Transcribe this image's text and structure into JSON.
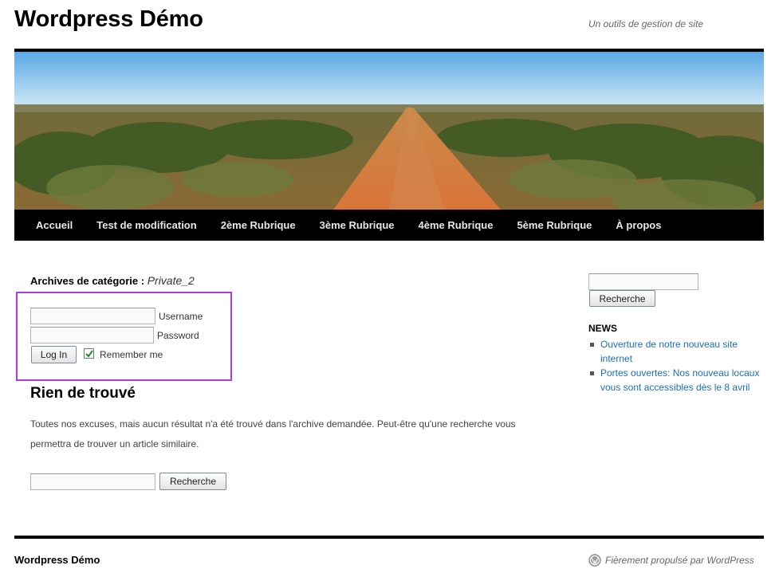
{
  "header": {
    "site_title": "Wordpress Démo",
    "site_description": "Un outils de gestion de site"
  },
  "nav": {
    "items": [
      {
        "label": "Accueil"
      },
      {
        "label": "Test de modification"
      },
      {
        "label": "2ème Rubrique"
      },
      {
        "label": "3ème Rubrique"
      },
      {
        "label": "4ème Rubrique"
      },
      {
        "label": "5ème Rubrique"
      },
      {
        "label": "À propos"
      }
    ]
  },
  "main": {
    "archive_prefix": "Archives de catégorie :",
    "archive_category": "Private_2",
    "login": {
      "username_label": "Username",
      "password_label": "Password",
      "username_value": "",
      "password_value": "",
      "login_button": "Log In",
      "remember_label": "Remember me",
      "remember_checked": true
    },
    "nothing_found_title": "Rien de trouvé",
    "nothing_found_text": "Toutes nos excuses, mais aucun résultat n'a été trouvé dans l'archive demandée. Peut-être qu'une recherche vous permettra de trouver un article similaire.",
    "search_value": "",
    "search_button": "Recherche"
  },
  "sidebar": {
    "search_value": "",
    "search_button": "Recherche",
    "news_title": "NEWS",
    "news_items": [
      {
        "label": "Ouverture de notre nouveau site internet"
      },
      {
        "label": "Portes ouvertes: Nos nouveau locaux vous sont accessibles dès le 8 avril"
      }
    ]
  },
  "footer": {
    "site_title": "Wordpress Démo",
    "credit": "Fièrement propulsé par WordPress"
  },
  "colors": {
    "accent_border": "#a93be8",
    "link": "#1b6fbd",
    "nav_bg": "#000000"
  },
  "icons": {
    "footer": "wordpress-logo-icon",
    "checkbox": "checkmark-icon"
  }
}
